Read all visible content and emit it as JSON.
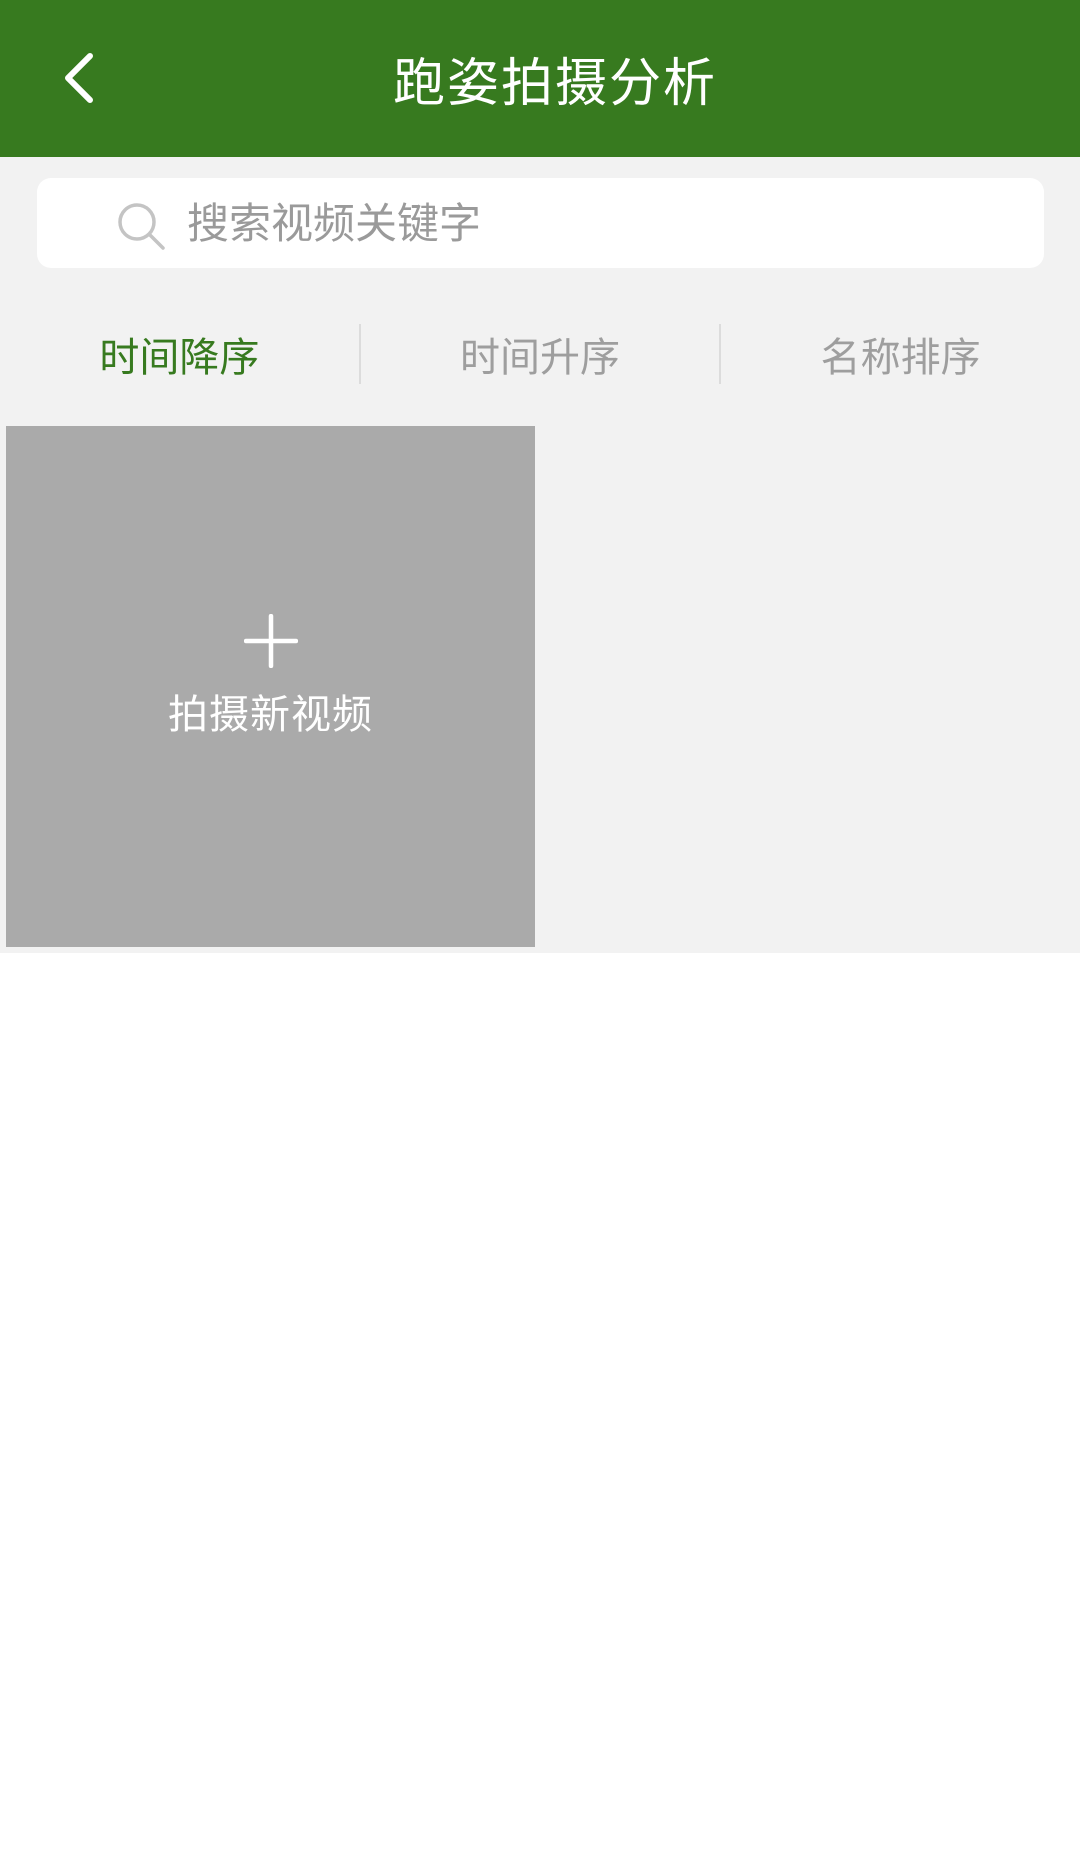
{
  "header": {
    "title": "跑姿拍摄分析",
    "back_icon": "chevron-left-icon",
    "background_color": "#377a1f"
  },
  "search": {
    "placeholder": "搜索视频关键字",
    "value": "",
    "icon": "search-icon"
  },
  "sort": {
    "tabs": [
      {
        "label": "时间降序",
        "active": true
      },
      {
        "label": "时间升序",
        "active": false
      },
      {
        "label": "名称排序",
        "active": false
      }
    ],
    "active_color": "#377a1f",
    "inactive_color": "#9e9e9e"
  },
  "new_video": {
    "label": "拍摄新视频",
    "icon": "plus-icon",
    "card_color": "#aaaaaa"
  }
}
